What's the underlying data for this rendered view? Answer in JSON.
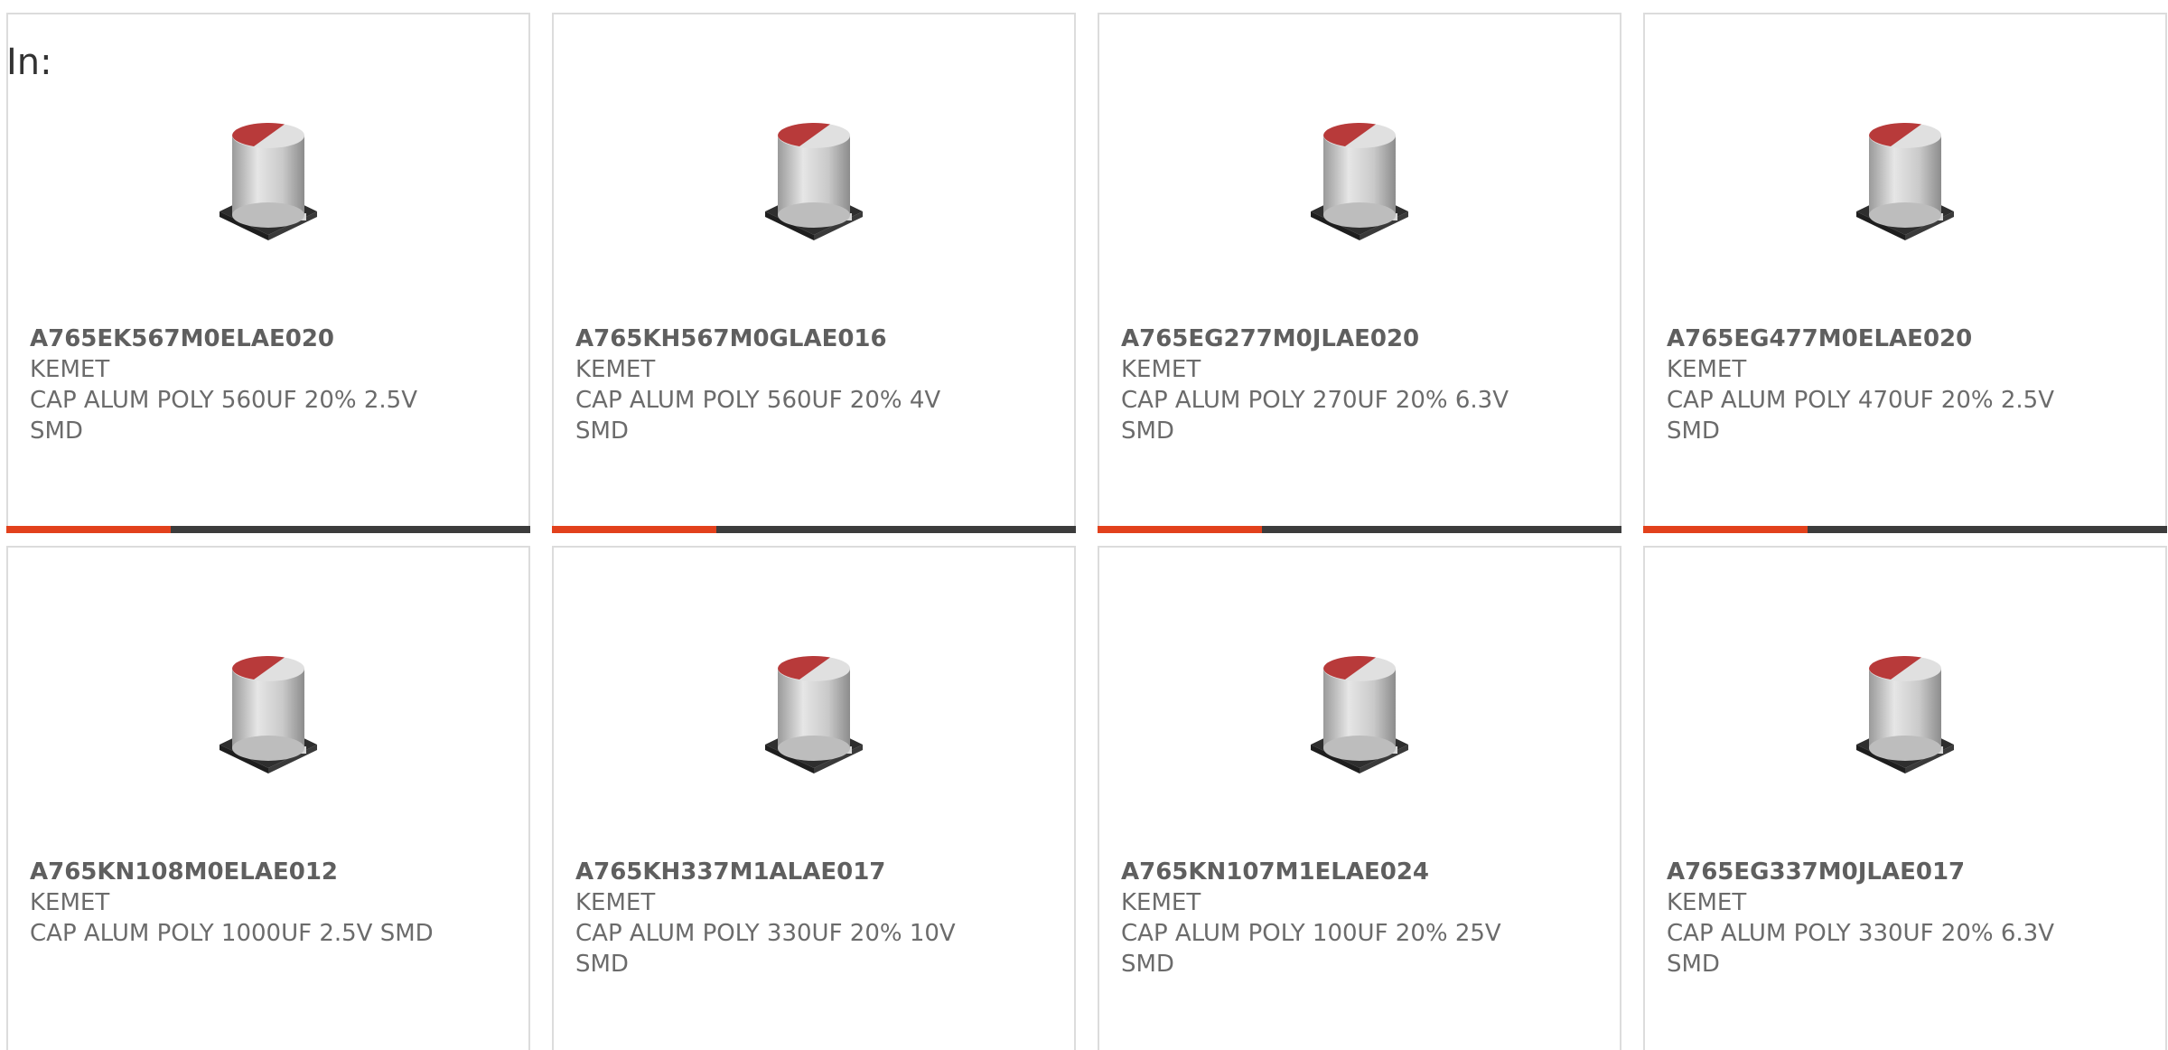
{
  "filter_label": "In:",
  "colors": {
    "bar_accent": "#e2411c",
    "bar_rest": "#3c3c3c",
    "part_top": "#b83a3a",
    "part_body": "#c9c9c9",
    "part_base": "#2e2e2e"
  },
  "image_icon": "capacitor-image",
  "cards": [
    {
      "part_number": "A765EK567M0ELAE020",
      "manufacturer": "KEMET",
      "description": "CAP ALUM POLY 560UF 20% 2.5V SMD",
      "has_bar": true
    },
    {
      "part_number": "A765KH567M0GLAE016",
      "manufacturer": "KEMET",
      "description": "CAP ALUM POLY 560UF 20% 4V SMD",
      "has_bar": true
    },
    {
      "part_number": "A765EG277M0JLAE020",
      "manufacturer": "KEMET",
      "description": "CAP ALUM POLY 270UF 20% 6.3V SMD",
      "has_bar": true
    },
    {
      "part_number": "A765EG477M0ELAE020",
      "manufacturer": "KEMET",
      "description": "CAP ALUM POLY 470UF 20% 2.5V SMD",
      "has_bar": true
    },
    {
      "part_number": "A765KN108M0ELAE012",
      "manufacturer": "KEMET",
      "description": "CAP ALUM POLY 1000UF 2.5V SMD",
      "has_bar": false
    },
    {
      "part_number": "A765KH337M1ALAE017",
      "manufacturer": "KEMET",
      "description": "CAP ALUM POLY 330UF 20% 10V SMD",
      "has_bar": false
    },
    {
      "part_number": "A765KN107M1ELAE024",
      "manufacturer": "KEMET",
      "description": "CAP ALUM POLY 100UF 20% 25V SMD",
      "has_bar": false
    },
    {
      "part_number": "A765EG337M0JLAE017",
      "manufacturer": "KEMET",
      "description": "CAP ALUM POLY 330UF 20% 6.3V SMD",
      "has_bar": false
    }
  ]
}
